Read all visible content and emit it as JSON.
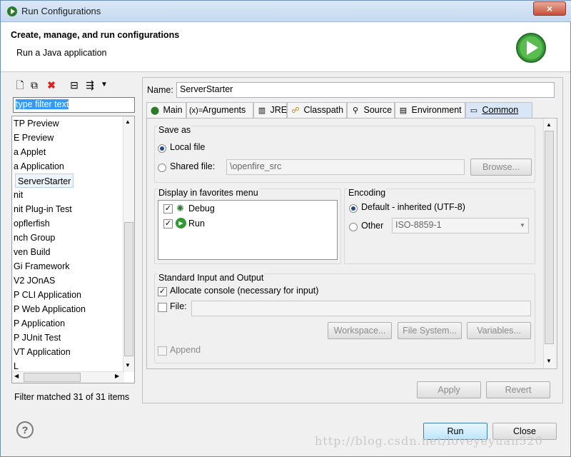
{
  "window": {
    "title": "Run Configurations"
  },
  "header": {
    "title": "Create, manage, and run configurations",
    "subtitle": "Run a Java application"
  },
  "left": {
    "filter_text": "type filter text",
    "tree_items": [
      "TP Preview",
      "E Preview",
      "a Applet",
      "a Application",
      "ServerStarter",
      "nit",
      "nit Plug-in Test",
      "opflerfish",
      "nch Group",
      "ven Build",
      "Gi Framework",
      "V2 JOnAS",
      "P CLI Application",
      "P Web Application",
      "P Application",
      "P JUnit Test",
      "VT Application",
      "L"
    ],
    "selected_item": "ServerStarter",
    "filter_status": "Filter matched 31 of 31 items"
  },
  "right": {
    "name_label": "Name:",
    "name_value": "ServerStarter",
    "tabs": [
      {
        "label": "Main",
        "icon": "main-icon"
      },
      {
        "label": "Arguments",
        "icon": "arguments-icon"
      },
      {
        "label": "JRE",
        "icon": "jre-icon"
      },
      {
        "label": "Classpath",
        "icon": "classpath-icon"
      },
      {
        "label": "Source",
        "icon": "source-icon"
      },
      {
        "label": "Environment",
        "icon": "environment-icon"
      },
      {
        "label": "Common",
        "icon": "common-icon",
        "active": true
      }
    ],
    "save_as": {
      "label": "Save as",
      "local": "Local file",
      "shared": "Shared file:",
      "shared_path": "\\openfire_src",
      "browse": "Browse..."
    },
    "favorites": {
      "label": "Display in favorites menu",
      "items": [
        "Debug",
        "Run"
      ]
    },
    "encoding": {
      "label": "Encoding",
      "default": "Default - inherited (UTF-8)",
      "other": "Other",
      "other_value": "ISO-8859-1"
    },
    "stdio": {
      "label": "Standard Input and Output",
      "allocate": "Allocate console (necessary for input)",
      "file": "File:",
      "workspace": "Workspace...",
      "filesystem": "File System...",
      "variables": "Variables...",
      "append": "Append"
    },
    "apply": "Apply",
    "revert": "Revert"
  },
  "footer": {
    "run": "Run",
    "close": "Close",
    "watermark": "http://blog.csdn.net/loveyeyuan520"
  }
}
